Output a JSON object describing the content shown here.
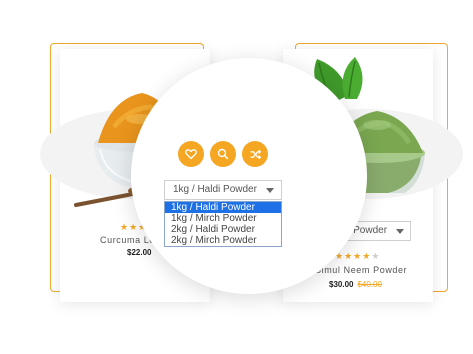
{
  "colors": {
    "accent": "#f5a623",
    "frame": "#f0a830",
    "selected_option_bg": "#1e70e6",
    "old_price": "#f5a623"
  },
  "products": [
    {
      "name": "Curcuma Long",
      "price": "$22.00",
      "rating": 3,
      "rating_max": 5,
      "image_icon": "turmeric-powder-bowl"
    },
    {
      "name": "Simul Neem Powder",
      "variant_selected": "/ Haldi Powder",
      "price": "$30.00",
      "old_price": "$40.00",
      "rating": 4,
      "rating_max": 5,
      "image_icon": "neem-powder-bowl"
    }
  ],
  "magnifier": {
    "actions": [
      {
        "icon": "heart-icon"
      },
      {
        "icon": "search-icon"
      },
      {
        "icon": "shuffle-icon"
      }
    ],
    "select": {
      "selected": "1kg / Haldi Powder",
      "options": [
        "1kg / Haldi Powder",
        "1kg / Mirch Powder",
        "2kg / Haldi Powder",
        "2kg / Mirch Powder"
      ],
      "highlighted_index": 0
    }
  }
}
